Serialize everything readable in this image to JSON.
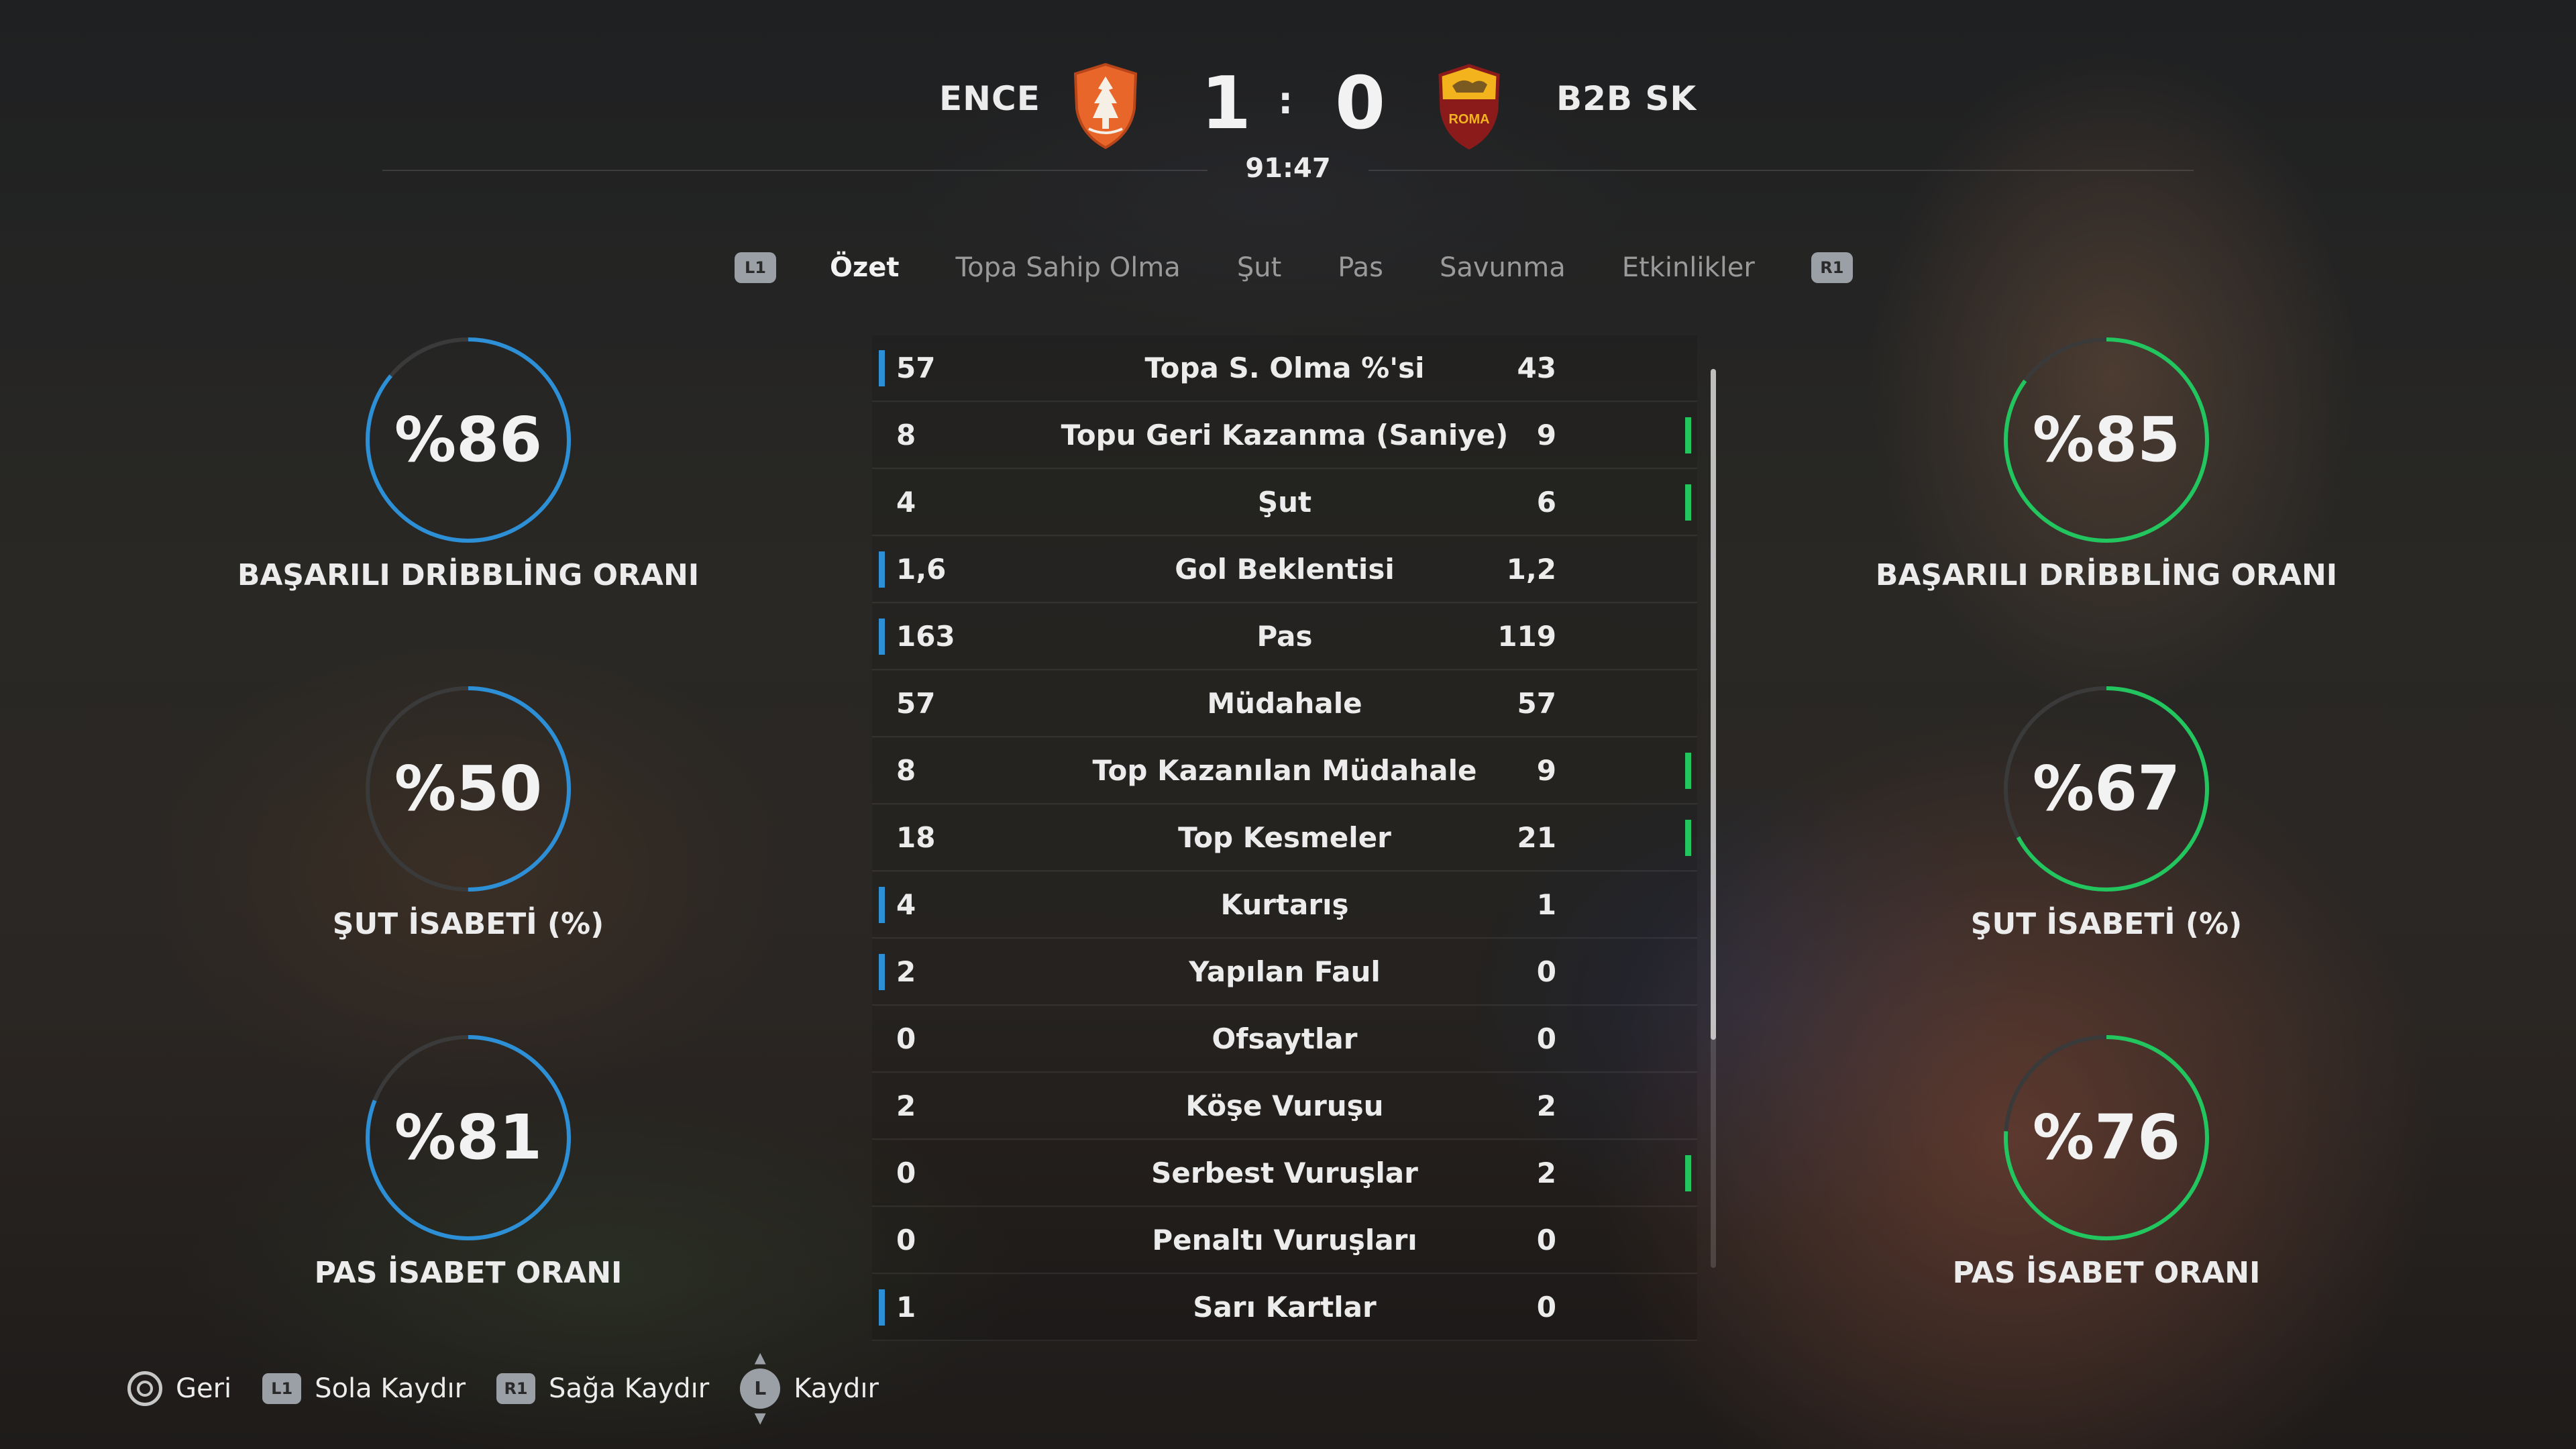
{
  "match": {
    "home_team": "ENCE",
    "away_team": "B2B SK",
    "home_score": "1",
    "separator": ":",
    "away_score": "0",
    "clock": "91:47"
  },
  "tabs": {
    "left_button": "L1",
    "right_button": "R1",
    "items": [
      "Özet",
      "Topa Sahip Olma",
      "Şut",
      "Pas",
      "Savunma",
      "Etkinlikler"
    ],
    "active": "Özet"
  },
  "home_rings": [
    {
      "value": "%86",
      "percent": 86,
      "label": "BAŞARILI DRİBBLİNG ORANI"
    },
    {
      "value": "%50",
      "percent": 50,
      "label": "ŞUT İSABETİ (%)"
    },
    {
      "value": "%81",
      "percent": 81,
      "label": "PAS İSABET ORANI"
    }
  ],
  "away_rings": [
    {
      "value": "%85",
      "percent": 85,
      "label": "BAŞARILI DRİBBLİNG ORANI"
    },
    {
      "value": "%67",
      "percent": 67,
      "label": "ŞUT İSABETİ (%)"
    },
    {
      "value": "%76",
      "percent": 76,
      "label": "PAS İSABET ORANI"
    }
  ],
  "colors": {
    "home_accent": "#2d8fd6",
    "away_accent": "#22c55e",
    "ring_track": "#3a3a3a"
  },
  "stats": [
    {
      "home": "57",
      "label": "Topa S. Olma %'si",
      "away": "43",
      "lead": "home"
    },
    {
      "home": "8",
      "label": "Topu Geri Kazanma (Saniye)",
      "away": "9",
      "lead": "away"
    },
    {
      "home": "4",
      "label": "Şut",
      "away": "6",
      "lead": "away"
    },
    {
      "home": "1,6",
      "label": "Gol Beklentisi",
      "away": "1,2",
      "lead": "home"
    },
    {
      "home": "163",
      "label": "Pas",
      "away": "119",
      "lead": "home"
    },
    {
      "home": "57",
      "label": "Müdahale",
      "away": "57",
      "lead": "none"
    },
    {
      "home": "8",
      "label": "Top Kazanılan Müdahale",
      "away": "9",
      "lead": "away"
    },
    {
      "home": "18",
      "label": "Top Kesmeler",
      "away": "21",
      "lead": "away"
    },
    {
      "home": "4",
      "label": "Kurtarış",
      "away": "1",
      "lead": "home"
    },
    {
      "home": "2",
      "label": "Yapılan Faul",
      "away": "0",
      "lead": "home"
    },
    {
      "home": "0",
      "label": "Ofsaytlar",
      "away": "0",
      "lead": "none"
    },
    {
      "home": "2",
      "label": "Köşe Vuruşu",
      "away": "2",
      "lead": "none"
    },
    {
      "home": "0",
      "label": "Serbest Vuruşlar",
      "away": "2",
      "lead": "away"
    },
    {
      "home": "0",
      "label": "Penaltı Vuruşları",
      "away": "0",
      "lead": "none"
    },
    {
      "home": "1",
      "label": "Sarı Kartlar",
      "away": "0",
      "lead": "home"
    }
  ],
  "footer": {
    "back": "Geri",
    "scroll_left_button": "L1",
    "scroll_left": "Sola Kaydır",
    "scroll_right_button": "R1",
    "scroll_right": "Sağa Kaydır",
    "stick_button": "L",
    "scroll": "Kaydır"
  },
  "icons": {
    "home_crest": "ence-crest-icon",
    "away_crest": "roma-crest-icon",
    "roma_crest_text": "ROMA"
  }
}
